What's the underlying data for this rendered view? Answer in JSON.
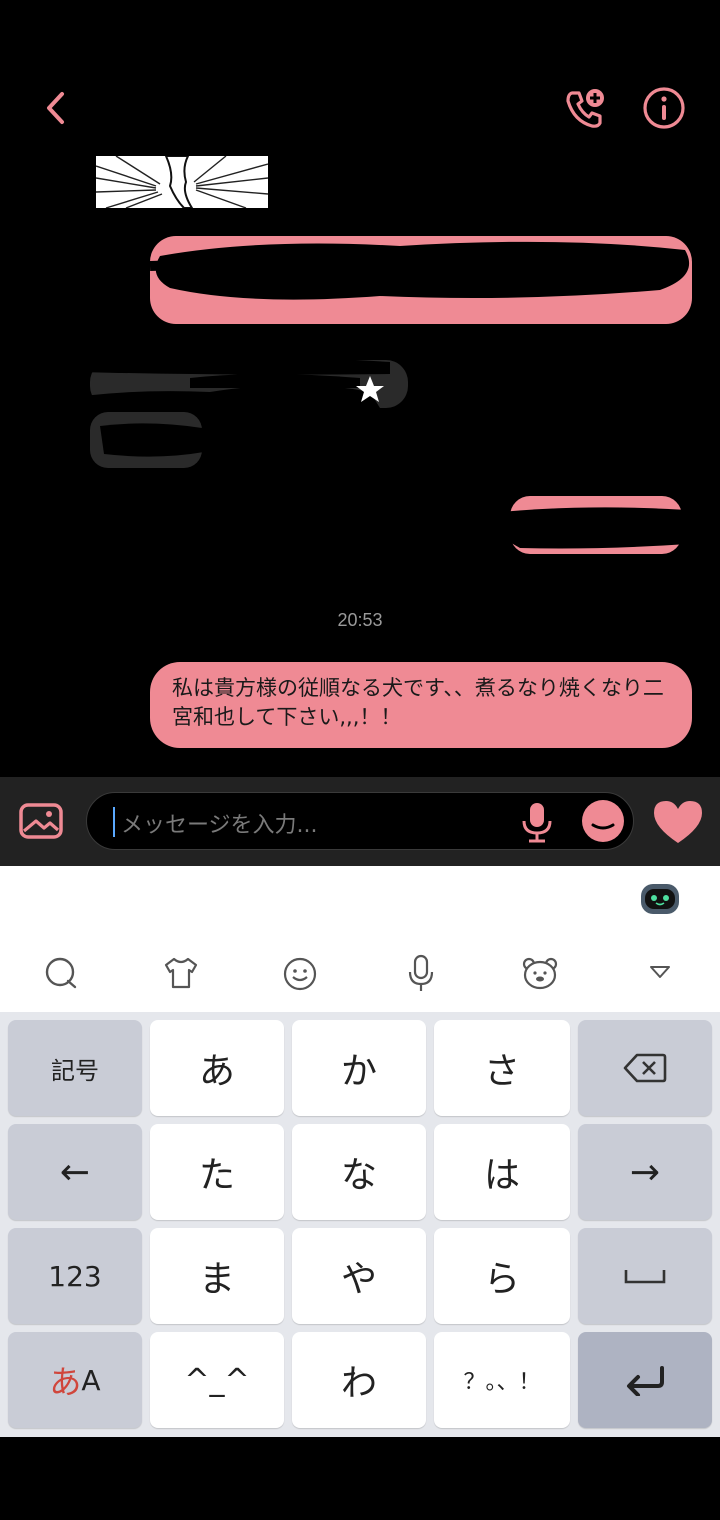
{
  "header": {
    "back_icon": "chevron-left-icon",
    "call_icon": "phone-add-icon",
    "info_icon": "info-icon"
  },
  "chat": {
    "timestamp": "20:53",
    "message": "私は貴方様の従順なる犬です、、煮るなり焼くなり二宮和也して下さい,,,！！"
  },
  "input_bar": {
    "placeholder": "メッセージを入力...",
    "image_icon": "image-icon",
    "mic_icon": "mic-icon",
    "emoji_icon": "emoji-icon",
    "heart_icon": "heart-icon"
  },
  "keyboard": {
    "toolbar": [
      "chat-bubble-icon",
      "shirt-icon",
      "smiley-icon",
      "mic-icon",
      "bear-icon",
      "collapse-icon"
    ],
    "rows": [
      [
        "記号",
        "あ",
        "か",
        "さ",
        "⌫"
      ],
      [
        "←",
        "た",
        "な",
        "は",
        "→"
      ],
      [
        "123",
        "ま",
        "や",
        "ら",
        "␣"
      ],
      [
        "あA",
        "^_^",
        "わ",
        "？。、！",
        "↵"
      ]
    ],
    "kana_mode_prefix": "あ",
    "kana_mode_suffix": "A"
  },
  "colors": {
    "accent": "#ef8a94",
    "background": "#000000",
    "keyboard_bg": "#e5e7ec"
  }
}
